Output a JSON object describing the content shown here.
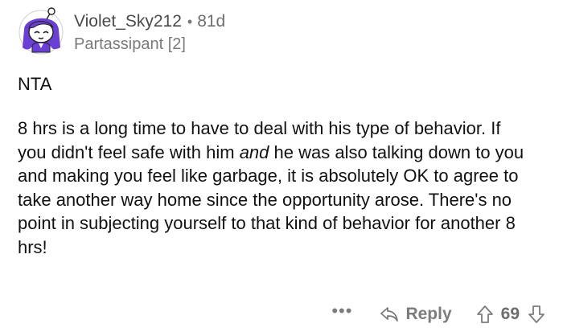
{
  "comment": {
    "author": {
      "username": "Violet_Sky212",
      "age": "81d",
      "flair": "Partassipant [2]",
      "avatar_icon": "snoo-avatar-purple-hair"
    },
    "verdict": "NTA",
    "body": {
      "part1": "8 hrs is a long time to have to deal with his type of behavior.  If you didn't feel safe with him ",
      "emphasis": "and",
      "part2": " he was also talking down to you and making you feel like garbage, it is absolutely OK to agree to take another way home since the opportunity arose.  There's no point in subjecting yourself to that kind of behavior for another 8 hrs!"
    },
    "actions": {
      "more_label": "•••",
      "reply_label": "Reply",
      "score": "69",
      "upvote_icon": "arrow-up-outline-icon",
      "downvote_icon": "arrow-down-outline-icon",
      "reply_icon": "reply-arrow-icon"
    }
  },
  "colors": {
    "avatar_purple": "#6b3fd4",
    "avatar_bg": "#ffffff",
    "meta_text": "#6f6f6f",
    "body_text": "#111111",
    "action_text": "#7c7c7c"
  }
}
